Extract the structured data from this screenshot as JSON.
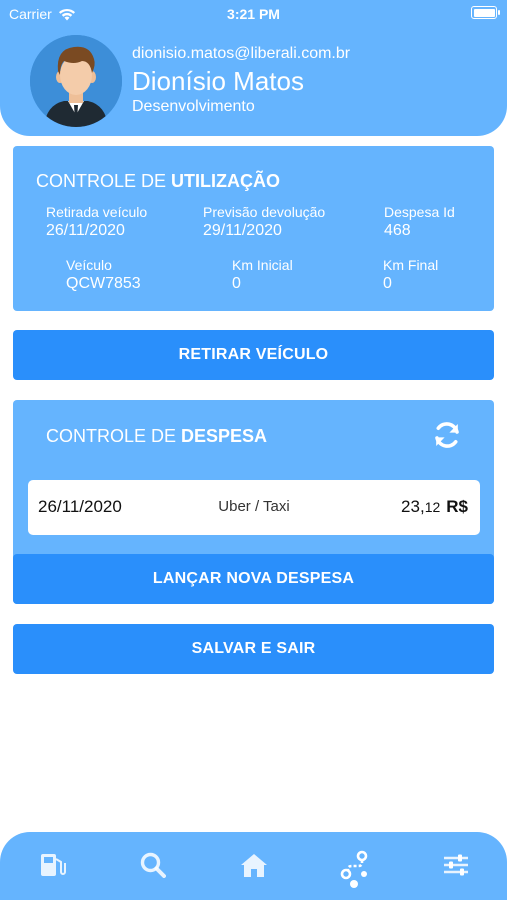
{
  "status_bar": {
    "carrier": "Carrier",
    "time": "3:21 PM"
  },
  "user": {
    "email": "dionisio.matos@liberali.com.br",
    "name": "Dionísio Matos",
    "department": "Desenvolvimento"
  },
  "usage": {
    "title_prefix": "CONTROLE DE ",
    "title_strong": "UTILIZAÇÃO",
    "fields": [
      {
        "label": "Retirada veículo",
        "value": "26/11/2020"
      },
      {
        "label": "Previsão devolução",
        "value": "29/11/2020"
      },
      {
        "label": "Despesa Id",
        "value": "468"
      },
      {
        "label": "Veículo",
        "value": "QCW7853"
      },
      {
        "label": "Km Inicial",
        "value": "0"
      },
      {
        "label": "Km Final",
        "value": "0"
      }
    ]
  },
  "buttons": {
    "retirar": "RETIRAR VEÍCULO",
    "lancar": "LANÇAR NOVA DESPESA",
    "salvar": "SALVAR E SAIR"
  },
  "expense": {
    "title_prefix": "CONTROLE DE ",
    "title_strong": "DESPESA",
    "items": [
      {
        "date": "26/11/2020",
        "category": "Uber / Taxi",
        "amount_int": "23,",
        "amount_cents": "12",
        "currency": "R$"
      }
    ]
  },
  "tabs": [
    {
      "icon": "fuel-icon"
    },
    {
      "icon": "search-icon"
    },
    {
      "icon": "home-icon"
    },
    {
      "icon": "route-icon",
      "active": true
    },
    {
      "icon": "sliders-icon"
    }
  ],
  "colors": {
    "primary": "#65b4fe",
    "button": "#2a8ffb",
    "text_light": "#ffffff"
  }
}
